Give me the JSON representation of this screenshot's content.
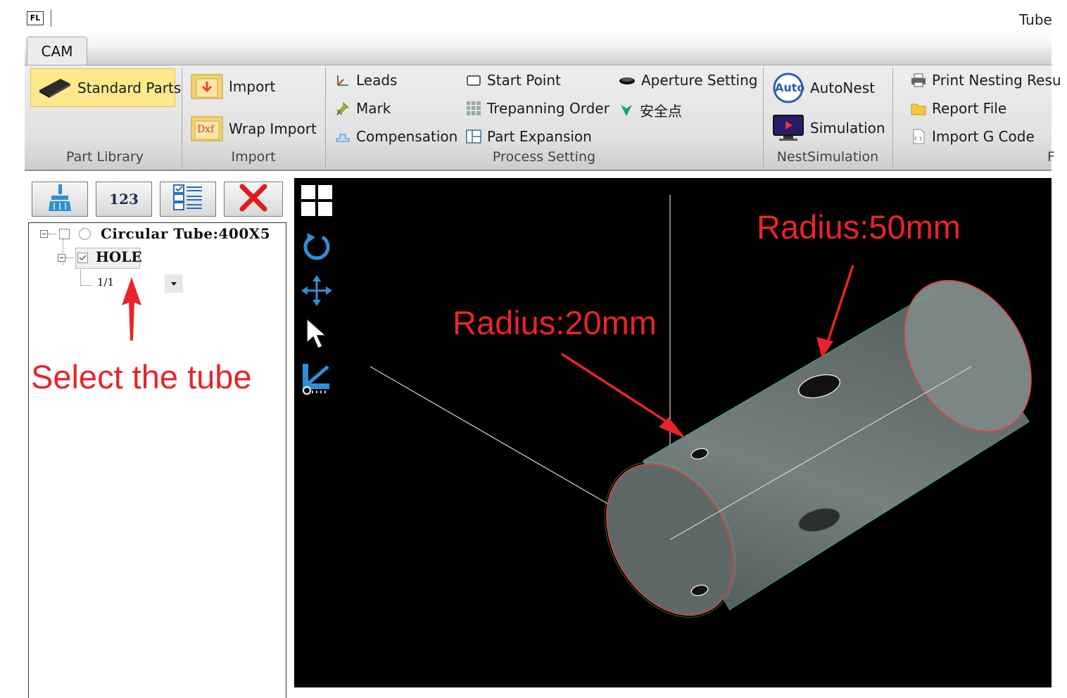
{
  "window": {
    "title": "Tube",
    "logo_text": "FL"
  },
  "tabs": [
    {
      "label": "CAM"
    }
  ],
  "ribbon": {
    "part_library": {
      "label": "Part Library",
      "standard_parts": "Standard Parts"
    },
    "import": {
      "label": "Import",
      "import_btn": "Import",
      "wrap_import": "Wrap Import",
      "dxf_icon_text": "Dxf"
    },
    "process_setting": {
      "label": "Process Setting",
      "leads": "Leads",
      "mark": "Mark",
      "compensation": "Compensation",
      "start_point": "Start Point",
      "trepanning_order": "Trepanning Order",
      "part_expansion": "Part Expansion",
      "aperture_setting": "Aperture Setting",
      "safe_point": "安全点"
    },
    "nest_simulation": {
      "label": "NestSimulation",
      "autonest": "AutoNest",
      "auto_icon_text": "Auto",
      "simulation": "Simulation"
    },
    "report": {
      "print_nesting": "Print Nesting Resu",
      "report_file": "Report File",
      "import_gcode": "Import G Code",
      "clipped_label": "F"
    }
  },
  "toolbar": {
    "number_label": "123"
  },
  "tree": {
    "root": "Circular Tube:400X5",
    "child": "HOLE",
    "grandchild": "1/1"
  },
  "annotations": {
    "select_tube": "Select the tube",
    "radius_20": "Radius:20mm",
    "radius_50": "Radius:50mm"
  },
  "colors": {
    "annotation": "#e8242a",
    "viewport_bg": "#000000",
    "tube_fill": "#6b7675",
    "highlight": "#fde98a",
    "view_icon": "#2f8fd8"
  }
}
